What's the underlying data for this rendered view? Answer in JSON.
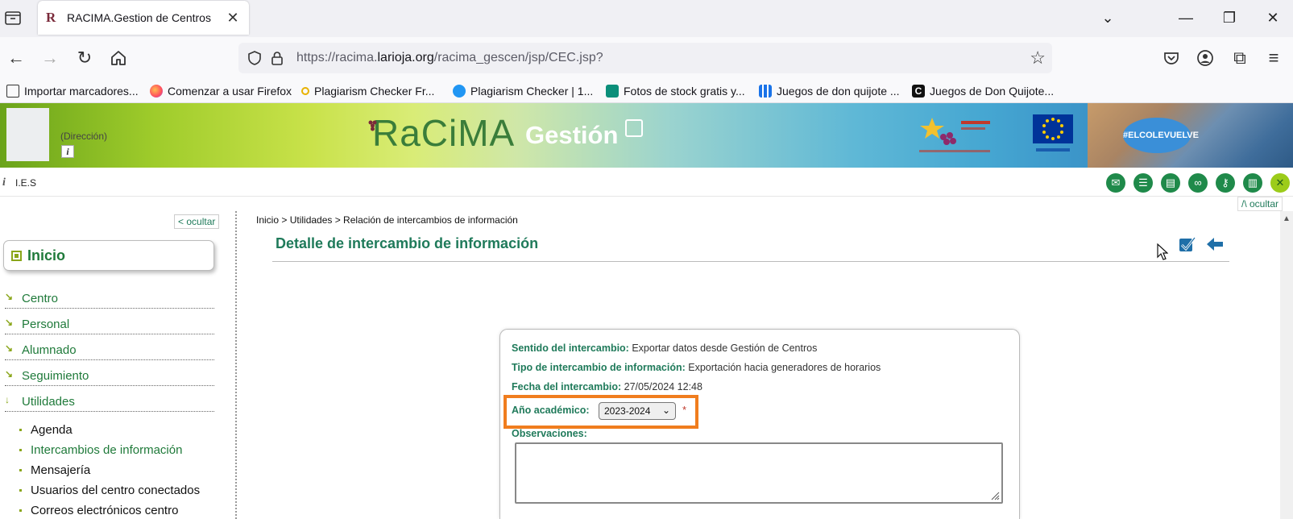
{
  "browser": {
    "tab_title": "RACIMA.Gestion de Centros",
    "tab_favicon": "R",
    "url_prefix": "https://racima.",
    "url_domain": "larioja.org",
    "url_path": "/racima_gescen/jsp/CEC.jsp?",
    "bookmarks": [
      "Importar marcadores...",
      "Comenzar a usar Firefox",
      "Plagiarism Checker Fr...",
      "Plagiarism Checker | 1...",
      "Fotos de stock gratis y...",
      "Juegos de don quijote ...",
      "Juegos de Don Quijote..."
    ]
  },
  "banner": {
    "direccion": "(Dirección)",
    "logo_racima": "RaCiMA",
    "logo_gestion": "Gestión",
    "hashtag": "#ELCOLEVUELVE"
  },
  "infobar": {
    "i_glyph": "i",
    "centro": "I.E.S",
    "ocultar_top": "/\\ ocultar"
  },
  "sidebar": {
    "ocultar": "< ocultar",
    "inicio": "Inicio",
    "menu": [
      "Centro",
      "Personal",
      "Alumnado",
      "Seguimiento",
      "Utilidades"
    ],
    "submenu": [
      "Agenda",
      "Intercambios de información",
      "Mensajería",
      "Usuarios del centro conectados",
      "Correos electrónicos centro"
    ]
  },
  "main": {
    "breadcrumb": "Inicio > Utilidades > Relación de intercambios de información",
    "title": "Detalle de intercambio de información",
    "form": {
      "sentido_label": "Sentido del intercambio:",
      "sentido_value": "Exportar datos desde Gestión de Centros",
      "tipo_label": "Tipo de intercambio de información:",
      "tipo_value": "Exportación hacia generadores de horarios",
      "fecha_label": "Fecha del intercambio:",
      "fecha_value": "27/05/2024 12:48",
      "anio_label": "Año académico:",
      "anio_value": "2023-2024",
      "required_mark": "*",
      "observaciones_label": "Observaciones:",
      "observaciones_value": ""
    }
  },
  "colors": {
    "accent_green": "#1f7a5a",
    "highlight_orange": "#f07d1e"
  }
}
